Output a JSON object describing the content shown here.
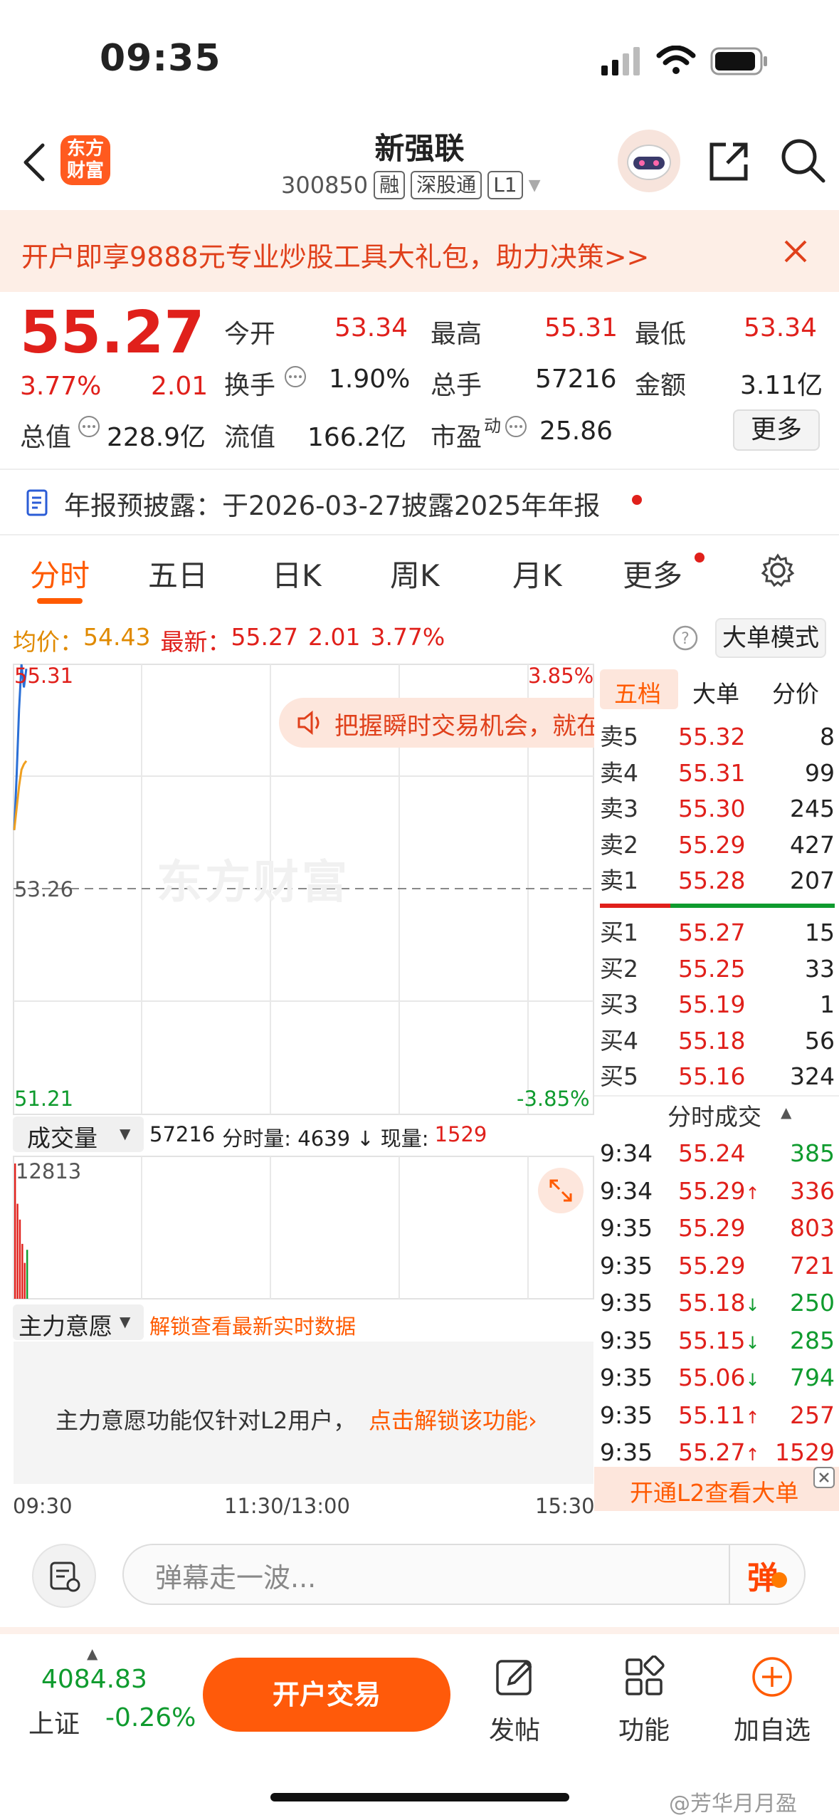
{
  "status": {
    "time": "09:35"
  },
  "header": {
    "logo_text_line1": "东方",
    "logo_text_line2": "财富",
    "stock_name": "新强联",
    "stock_code": "300850",
    "tags": [
      "融",
      "深股通",
      "L1"
    ]
  },
  "banner": {
    "text": "开户即享9888元专业炒股工具大礼包，助力决策>>"
  },
  "quote": {
    "price": "55.27",
    "change_pct": "3.77%",
    "change": "2.01",
    "open_label": "今开",
    "open": "53.34",
    "high_label": "最高",
    "high": "55.31",
    "low_label": "最低",
    "low": "53.34",
    "turnover_label": "换手",
    "turnover": "1.90%",
    "volume_label": "总手",
    "volume": "57216",
    "amount_label": "金额",
    "amount": "3.11亿",
    "mktcap_label": "总值",
    "mktcap": "228.9亿",
    "float_label": "流值",
    "float": "166.2亿",
    "pe_label": "市盈",
    "pe_sup": "动",
    "pe": "25.86",
    "more_label": "更多"
  },
  "notice": {
    "text": "年报预披露：于2026-03-27披露2025年年报"
  },
  "tabs": [
    "分时",
    "五日",
    "日K",
    "周K",
    "月K",
    "更多"
  ],
  "info_line": {
    "avg_label": "均价：",
    "avg": "54.43",
    "latest_label": "最新：",
    "latest": "55.27",
    "chg": "2.01",
    "pct": "3.77%",
    "big_order_label": "大单模式"
  },
  "chart": {
    "y_top": "55.31",
    "y_mid": "53.26",
    "y_bot": "51.21",
    "pct_top": "3.85%",
    "pct_bot": "-3.85%",
    "promo": "把握瞬时交易机会，就在",
    "watermark": "东方财富",
    "vol_selector": "成交量",
    "vol_info_total": "57216",
    "vol_info_rest": "分时量: 4639 ↓ 现量:",
    "vol_info_now": "1529",
    "vol_max": "12813",
    "main_selector": "主力意愿",
    "main_unlock": "解锁查看最新实时数据",
    "main_msg": "主力意愿功能仅针对L2用户，",
    "main_link": "点击解锁该功能",
    "x_start": "09:30",
    "x_mid": "11:30/13:00",
    "x_end": "15:30"
  },
  "chart_data": {
    "type": "line",
    "series": [
      {
        "name": "",
        "x": [
          "09:30",
          "09:31",
          "09:32",
          "09:33",
          "09:34",
          "09:35"
        ],
        "values": [
          53.8,
          54.3,
          54.9,
          55.31,
          55.1,
          55.27
        ]
      },
      {
        "name": "",
        "x": [
          "09:30",
          "09:31",
          "09:32",
          "09:33",
          "09:34",
          "09:35"
        ],
        "values": [
          53.8,
          54.0,
          54.2,
          54.35,
          54.4,
          54.43
        ]
      }
    ],
    "ylim": [
      51.21,
      55.31
    ],
    "volume": [
      12813,
      9000,
      7500,
      5200,
      3400,
      4639
    ]
  },
  "panel": {
    "tabs": [
      "五档",
      "大单",
      "分价"
    ],
    "sells": [
      {
        "label": "卖5",
        "price": "55.32",
        "qty": "8"
      },
      {
        "label": "卖4",
        "price": "55.31",
        "qty": "99"
      },
      {
        "label": "卖3",
        "price": "55.30",
        "qty": "245"
      },
      {
        "label": "卖2",
        "price": "55.29",
        "qty": "427"
      },
      {
        "label": "卖1",
        "price": "55.28",
        "qty": "207"
      }
    ],
    "buys": [
      {
        "label": "买1",
        "price": "55.27",
        "qty": "15"
      },
      {
        "label": "买2",
        "price": "55.25",
        "qty": "33"
      },
      {
        "label": "买3",
        "price": "55.19",
        "qty": "1"
      },
      {
        "label": "买4",
        "price": "55.18",
        "qty": "56"
      },
      {
        "label": "买5",
        "price": "55.16",
        "qty": "324"
      }
    ],
    "trades_title": "分时成交",
    "trades": [
      {
        "time": "9:34",
        "price": "55.24",
        "arrow": "",
        "qty": "385",
        "dir": "buy"
      },
      {
        "time": "9:34",
        "price": "55.29",
        "arrow": "↑",
        "qty": "336",
        "dir": "sell"
      },
      {
        "time": "9:35",
        "price": "55.29",
        "arrow": "",
        "qty": "803",
        "dir": "sell"
      },
      {
        "time": "9:35",
        "price": "55.29",
        "arrow": "",
        "qty": "721",
        "dir": "sell"
      },
      {
        "time": "9:35",
        "price": "55.18",
        "arrow": "↓",
        "qty": "250",
        "dir": "buy"
      },
      {
        "time": "9:35",
        "price": "55.15",
        "arrow": "↓",
        "qty": "285",
        "dir": "buy"
      },
      {
        "time": "9:35",
        "price": "55.06",
        "arrow": "↓",
        "qty": "794",
        "dir": "buy"
      },
      {
        "time": "9:35",
        "price": "55.11",
        "arrow": "↑",
        "qty": "257",
        "dir": "sell"
      },
      {
        "time": "9:35",
        "price": "55.27",
        "arrow": "↑",
        "qty": "1529",
        "dir": "sell"
      }
    ],
    "l2_promo": "开通L2查看大单"
  },
  "comment": {
    "placeholder": "弹幕走一波...",
    "danmu_btn": "弹"
  },
  "bottom": {
    "index_value": "4084.83",
    "index_name": "上证",
    "index_pct": "-0.26%",
    "trade_btn": "开户交易",
    "nav": [
      "发帖",
      "功能",
      "加自选"
    ]
  },
  "footer": {
    "watermark": "@芳华月月盈"
  },
  "colors": {
    "up": "#e0201b",
    "down": "#0f9b2e",
    "accent": "#ff5a00"
  }
}
